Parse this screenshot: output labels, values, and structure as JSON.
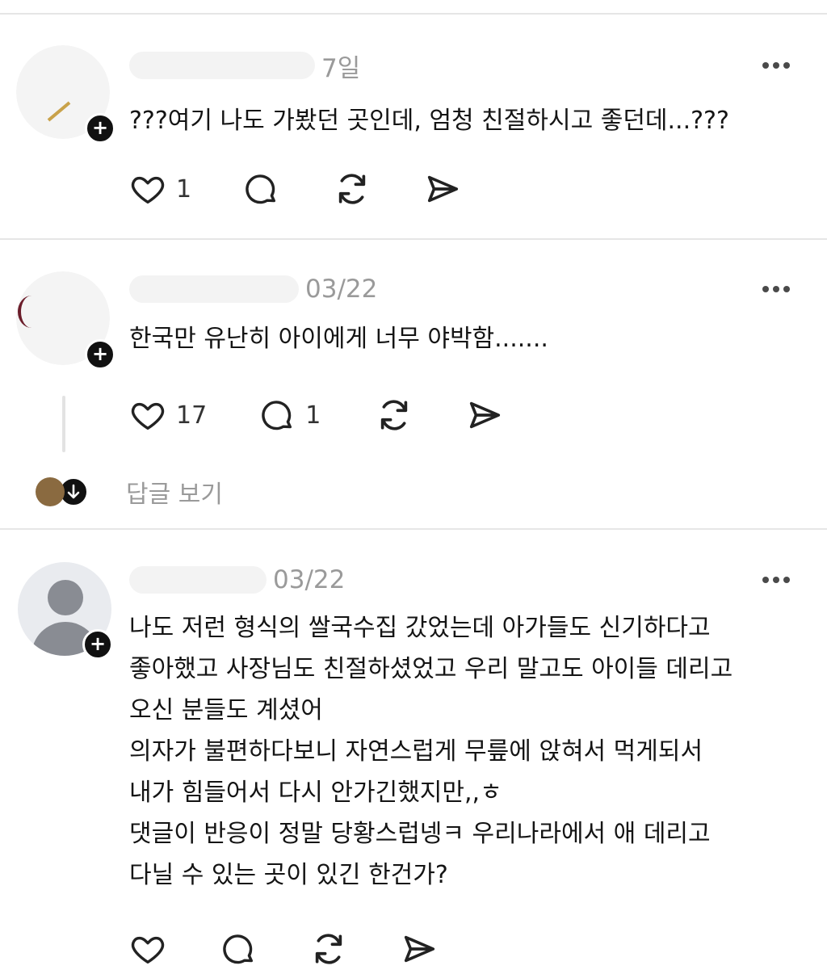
{
  "posts": [
    {
      "time": "7일",
      "lines": [
        "???여기 나도 가봤던 곳인데, 엄청 친절하시고 좋던데...???"
      ],
      "like_count": "1",
      "reply_count": "",
      "like_icon": "heart-icon",
      "reply_icon": "comment-icon",
      "repost_icon": "repost-icon",
      "share_icon": "send-icon"
    },
    {
      "time": "03/22",
      "lines": [
        "한국만 유난히 아이에게 너무 야박함......."
      ],
      "like_count": "17",
      "reply_count": "1",
      "replies_label": "답글 보기"
    },
    {
      "time": "03/22",
      "lines": [
        "나도 저런 형식의 쌀국수집 갔었는데 아가들도 신기하다고",
        "좋아했고 사장님도 친절하셨었고 우리 말고도 아이들 데리고",
        "오신 분들도 계셨어",
        "의자가 불편하다보니 자연스럽게 무릎에 앉혀서 먹게되서",
        "내가 힘들어서 다시 안가긴했지만,,ㅎ",
        "댓글이 반응이 정말 당황스럽넹ㅋ 우리나라에서 애 데리고",
        "다닐 수 있는 곳이 있긴 한건가?"
      ],
      "like_count": "",
      "reply_count": ""
    }
  ],
  "colors": {
    "text": "#141414",
    "muted": "#9a9a9a",
    "divider": "#e6e6e6",
    "badge": "#111111"
  }
}
